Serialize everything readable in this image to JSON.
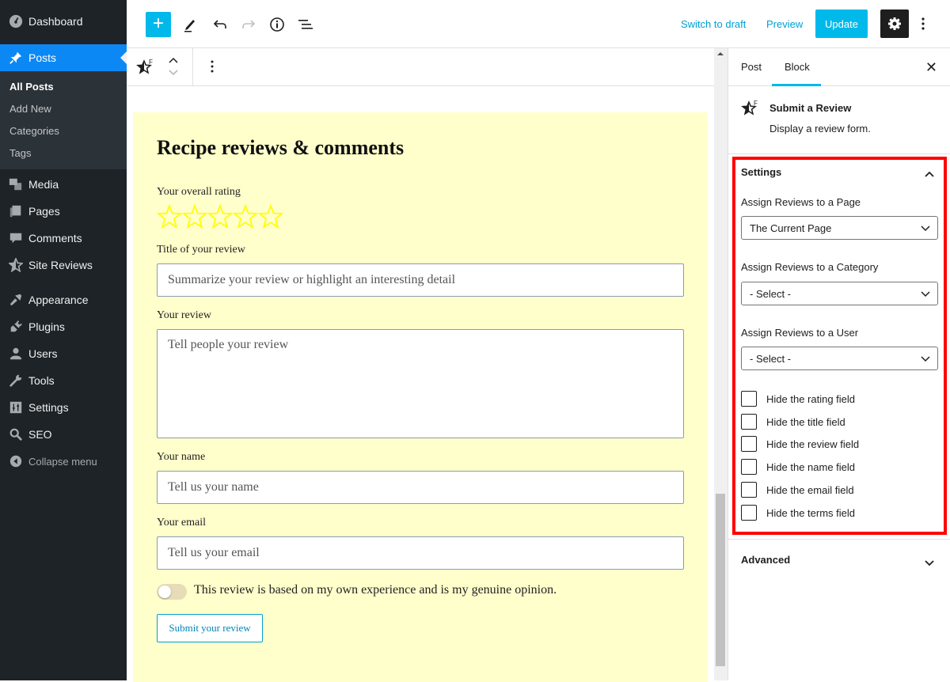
{
  "sidebar": {
    "items": [
      {
        "label": "Dashboard",
        "icon": "dashboard-icon"
      },
      {
        "label": "Posts",
        "icon": "pin-icon",
        "active": true
      },
      {
        "label": "Media",
        "icon": "media-icon"
      },
      {
        "label": "Pages",
        "icon": "pages-icon"
      },
      {
        "label": "Comments",
        "icon": "comments-icon"
      },
      {
        "label": "Site Reviews",
        "icon": "star-icon"
      },
      {
        "label": "Appearance",
        "icon": "paintbrush-icon"
      },
      {
        "label": "Plugins",
        "icon": "plugin-icon"
      },
      {
        "label": "Users",
        "icon": "user-icon"
      },
      {
        "label": "Tools",
        "icon": "wrench-icon"
      },
      {
        "label": "Settings",
        "icon": "settings-icon"
      },
      {
        "label": "SEO",
        "icon": "search-icon"
      }
    ],
    "submenu": [
      "All Posts",
      "Add New",
      "Categories",
      "Tags"
    ],
    "collapse_label": "Collapse menu"
  },
  "topbar": {
    "switch_to_draft": "Switch to draft",
    "preview": "Preview",
    "update": "Update"
  },
  "block": {
    "title": "Recipe reviews & comments",
    "rating_label": "Your overall rating",
    "rating_value": 0,
    "rating_max": 5,
    "star_color": "#ffff00",
    "title_label": "Title of your review",
    "title_placeholder": "Summarize your review or highlight an interesting detail",
    "review_label": "Your review",
    "review_placeholder": "Tell people your review",
    "name_label": "Your name",
    "name_placeholder": "Tell us your name",
    "email_label": "Your email",
    "email_placeholder": "Tell us your email",
    "terms_label": "This review is based on my own experience and is my genuine opinion.",
    "terms_checked": false,
    "submit_label": "Submit your review",
    "background": "#ffffcc"
  },
  "panel": {
    "tabs": [
      "Post",
      "Block"
    ],
    "active_tab": "Block",
    "block_name": "Submit a Review",
    "block_desc": "Display a review form.",
    "settings": {
      "title": "Settings",
      "page_label": "Assign Reviews to a Page",
      "page_value": "The Current Page",
      "category_label": "Assign Reviews to a Category",
      "category_value": "- Select -",
      "user_label": "Assign Reviews to a User",
      "user_value": "- Select -",
      "checkboxes": [
        {
          "label": "Hide the rating field",
          "checked": false
        },
        {
          "label": "Hide the title field",
          "checked": false
        },
        {
          "label": "Hide the review field",
          "checked": false
        },
        {
          "label": "Hide the name field",
          "checked": false
        },
        {
          "label": "Hide the email field",
          "checked": false
        },
        {
          "label": "Hide the terms field",
          "checked": false
        }
      ]
    },
    "advanced_title": "Advanced",
    "highlight_color": "#ff0000"
  }
}
